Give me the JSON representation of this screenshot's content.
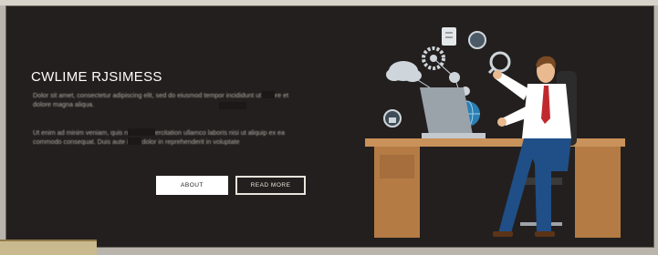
{
  "hero": {
    "title": "CWLIME RJSIMESS",
    "paragraph1": "Dolor sit amet, consectetur adipiscing elit, sed do eiusmod tempor incididunt ut labore et dolore magna aliqua.",
    "paragraph2": "Ut enim ad minim veniam, quis nostrud exercitation ullamco laboris nisi ut aliquip ex ea commodo consequat. Duis aute irure dolor in reprehenderit in voluptate",
    "about_label": "ABOUT",
    "read_more_label": "READ MORE"
  },
  "colors": {
    "panel_bg": "#231f1e",
    "desk": "#c8925a",
    "shirt": "#ffffff",
    "tie": "#c0282d",
    "trousers": "#1f4f86",
    "laptop": "#9aa2aa",
    "cloud_icons": "#cfd6db"
  },
  "illustration": {
    "icons": [
      "cloud-icon",
      "gear-icon",
      "document-icon",
      "chat-bubble-icon",
      "wrench-icon",
      "globe-icon",
      "lock-icon",
      "bulb-icon"
    ]
  }
}
